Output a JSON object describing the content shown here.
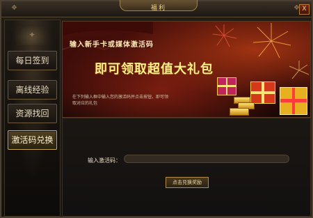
{
  "window": {
    "title": "福利",
    "close_label": "X"
  },
  "sidebar": {
    "items": [
      {
        "label": "每日签到",
        "active": false
      },
      {
        "label": "离线经验",
        "active": false
      },
      {
        "label": "资源找回",
        "active": false
      },
      {
        "label": "激活码兑换",
        "active": true
      }
    ]
  },
  "banner": {
    "headline": "输入新手卡或媒体激活码",
    "main_text": "即可领取超值大礼包",
    "description": "在下列输入框中输入您的激活码并点击按钮，即可领取对应的礼包"
  },
  "form": {
    "code_label": "输入激活码：",
    "code_value": "",
    "redeem_button": "点击兑换奖励"
  },
  "colors": {
    "accent_gold": "#f3d68a",
    "banner_red": "#4a0f0a",
    "main_text_yellow": "#fff08a"
  }
}
